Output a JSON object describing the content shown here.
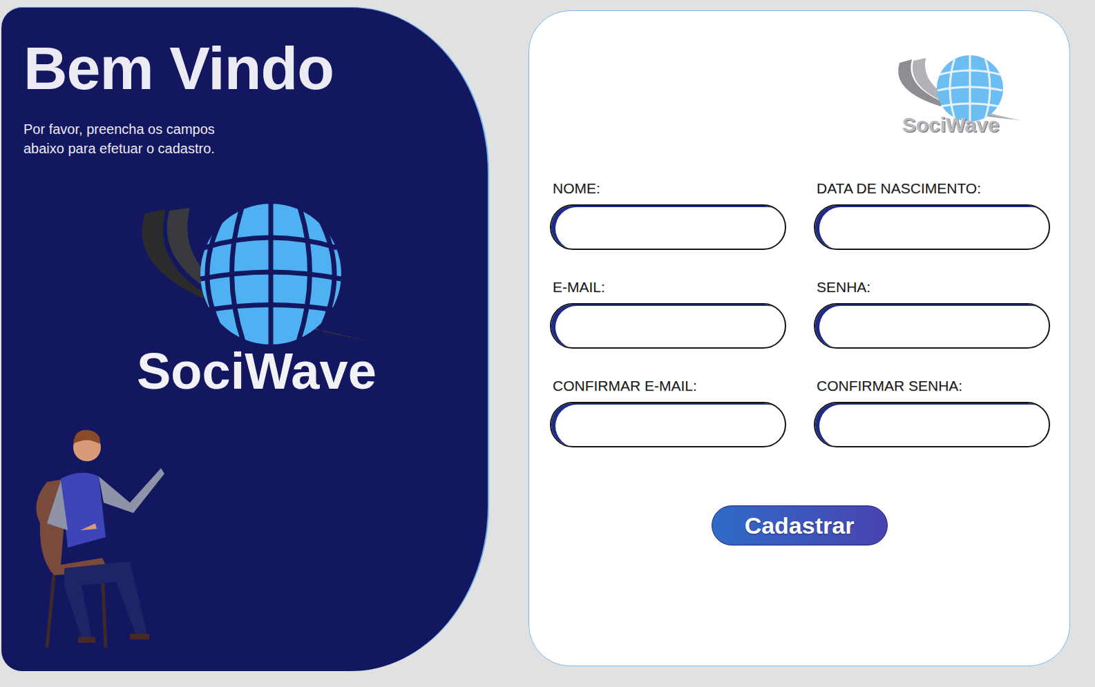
{
  "welcome": {
    "title": "Bem Vindo",
    "subtitle_lines": [
      "Por favor, preencha os campos",
      "abaixo para efetuar o cadastro."
    ]
  },
  "brand": {
    "name": "SociWave"
  },
  "header_logo": {
    "name": "SociWave"
  },
  "form": {
    "fields": [
      {
        "label": "NOME:"
      },
      {
        "label": "DATA DE NASCIMENTO:"
      },
      {
        "label": "E-MAIL:"
      },
      {
        "label": "SENHA:"
      },
      {
        "label": "CONFIRMAR E-MAIL:"
      },
      {
        "label": "CONFIRMAR SENHA:"
      }
    ],
    "submit": "Cadastrar"
  }
}
